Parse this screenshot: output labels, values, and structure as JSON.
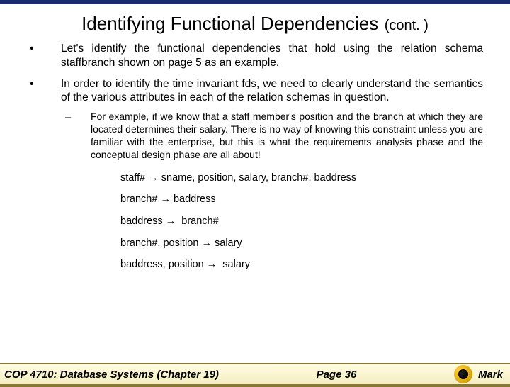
{
  "title": {
    "main": "Identifying Functional Dependencies",
    "suffix": "(cont. )"
  },
  "bullets": {
    "b1_pre": "Let's identify the functional dependencies that hold using the relation schema ",
    "b1_schema": "staffbranch",
    "b1_post": " shown on page 5 as an example.",
    "b2": "In order to identify the time invariant fds, we need to clearly understand the semantics of the various attributes in each of the relation schemas in question.",
    "sub1": "For example, if we know that a staff member's position and the branch at which they are located determines their salary.  There is no way of knowing this constraint unless you are familiar with the enterprise, but this is what the requirements analysis phase and the conceptual design phase are all about!"
  },
  "fds": {
    "f1_lhs": "staff#",
    "f1_rhs": "sname, position, salary, branch#, baddress",
    "f2_lhs": "branch#",
    "f2_rhs": "baddress",
    "f3_lhs": "baddress",
    "f3_rhs": "branch#",
    "f4_lhs": "branch#, position",
    "f4_rhs": "salary",
    "f5_lhs": "baddress, position",
    "f5_rhs": "salary"
  },
  "footer": {
    "left": "COP 4710: Database Systems  (Chapter 19)",
    "center": "Page 36",
    "right": "Mark"
  }
}
